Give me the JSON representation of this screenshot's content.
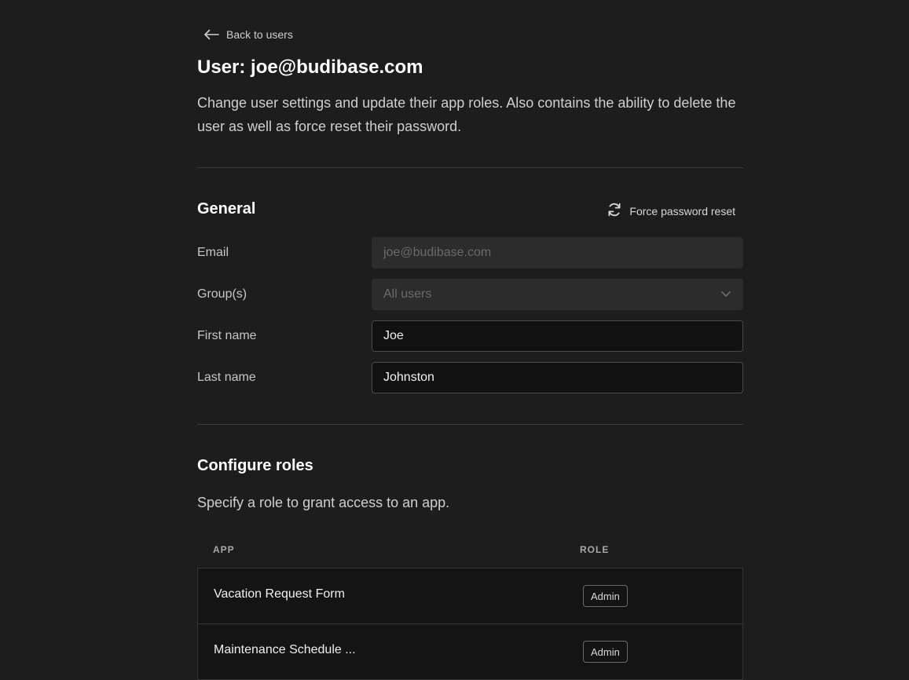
{
  "nav": {
    "back_label": "Back to users"
  },
  "header": {
    "title": "User: joe@budibase.com",
    "description": "Change user settings and update their app roles. Also contains the ability to delete the user as well as force reset their password."
  },
  "general": {
    "title": "General",
    "force_reset_label": "Force password reset",
    "fields": [
      {
        "label": "Email",
        "value": "joe@budibase.com",
        "disabled": true
      },
      {
        "label": "Group(s)",
        "value": "All users",
        "disabled": true,
        "type": "select"
      },
      {
        "label": "First name",
        "value": "Joe",
        "disabled": false
      },
      {
        "label": "Last name",
        "value": "Johnston",
        "disabled": false
      }
    ]
  },
  "roles": {
    "title": "Configure roles",
    "description": "Specify a role to grant access to an app.",
    "columns": {
      "app": "APP",
      "role": "ROLE"
    },
    "rows": [
      {
        "app": "Vacation Request Form",
        "role": "Admin"
      },
      {
        "app": "Maintenance Schedule ...",
        "role": "Admin"
      }
    ]
  },
  "icons": {
    "back": "arrow-left-icon",
    "force_reset": "refresh-icon",
    "select_caret": "chevron-down-icon"
  },
  "colors": {
    "background": "#1d1d1d",
    "text_primary": "#ffffff",
    "field_disabled_bg": "#2c2c2c",
    "field_enabled_bg": "#111111"
  }
}
